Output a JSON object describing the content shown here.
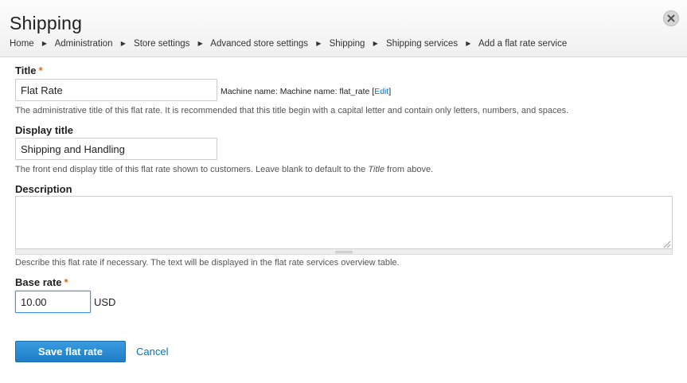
{
  "page": {
    "title": "Shipping"
  },
  "breadcrumb": [
    {
      "label": "Home"
    },
    {
      "label": "Administration"
    },
    {
      "label": "Store settings"
    },
    {
      "label": "Advanced store settings"
    },
    {
      "label": "Shipping"
    },
    {
      "label": "Shipping services"
    },
    {
      "label": "Add a flat rate service"
    }
  ],
  "icons": {
    "close": "close-icon",
    "separator": "triangle-right-icon"
  },
  "colors": {
    "required": "#e06c1b",
    "link": "#0074bd",
    "primary_button": "#2a8ad6"
  },
  "form": {
    "title": {
      "label": "Title",
      "required_mark": "*",
      "value": "Flat Rate",
      "machine_name_prefix": "Machine name: Machine name: flat_rate",
      "machine_name_edit_open": "[",
      "machine_name_edit_label": "Edit",
      "machine_name_edit_close": "]",
      "description": "The administrative title of this flat rate. It is recommended that this title begin with a capital letter and contain only letters, numbers, and spaces."
    },
    "display_title": {
      "label": "Display title",
      "value": "Shipping and Handling",
      "description_before": "The front end display title of this flat rate shown to customers. Leave blank to default to the ",
      "description_em": "Title",
      "description_after": " from above."
    },
    "description": {
      "label": "Description",
      "value": "",
      "description": "Describe this flat rate if necessary. The text will be displayed in the flat rate services overview table."
    },
    "base_rate": {
      "label": "Base rate",
      "required_mark": "*",
      "value": "10.00",
      "unit": "USD"
    }
  },
  "actions": {
    "save_label": "Save flat rate",
    "cancel_label": "Cancel"
  }
}
